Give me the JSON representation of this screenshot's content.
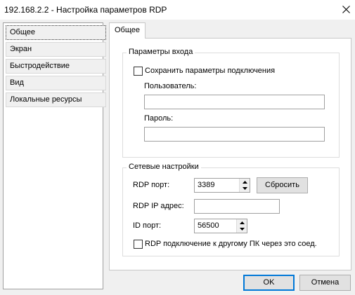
{
  "window": {
    "title": "192.168.2.2 - Настройка параметров RDP",
    "close_icon": "close-icon"
  },
  "sidebar": {
    "items": [
      {
        "label": "Общее",
        "selected": true
      },
      {
        "label": "Экран",
        "selected": false
      },
      {
        "label": "Быстродействие",
        "selected": false
      },
      {
        "label": "Вид",
        "selected": false
      },
      {
        "label": "Локальные ресурсы",
        "selected": false
      }
    ]
  },
  "tab": {
    "label": "Общее"
  },
  "login_group": {
    "title": "Параметры входа",
    "save_checkbox_label": "Сохранить параметры подключения",
    "save_checked": false,
    "user_label": "Пользователь:",
    "user_value": "",
    "password_label": "Пароль:",
    "password_value": ""
  },
  "network_group": {
    "title": "Сетевые настройки",
    "rdp_port_label": "RDP порт:",
    "rdp_port_value": "3389",
    "reset_label": "Сбросить",
    "rdp_ip_label": "RDP IP адрес:",
    "rdp_ip_value": "",
    "id_port_label": "ID порт:",
    "id_port_value": "56500",
    "relay_checkbox_label": "RDP подключение к другому ПК через это соед.",
    "relay_checked": false
  },
  "buttons": {
    "ok": "OK",
    "cancel": "Отмена"
  },
  "colors": {
    "accent": "#0078d7",
    "window_bg": "#f0f0f0"
  }
}
